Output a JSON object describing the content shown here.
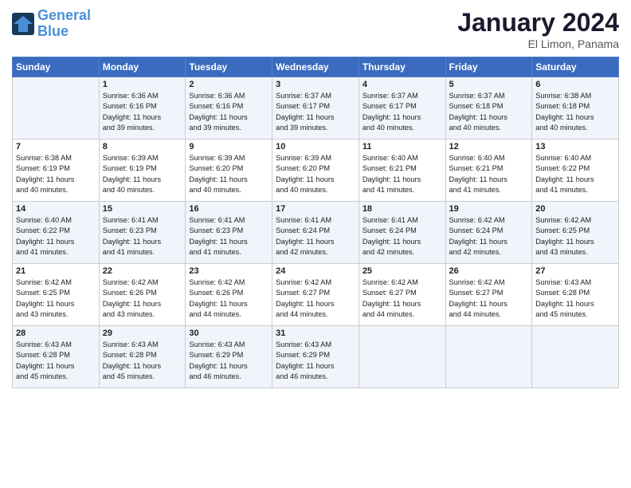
{
  "header": {
    "logo_line1": "General",
    "logo_line2": "Blue",
    "month_title": "January 2024",
    "location": "El Limon, Panama"
  },
  "weekdays": [
    "Sunday",
    "Monday",
    "Tuesday",
    "Wednesday",
    "Thursday",
    "Friday",
    "Saturday"
  ],
  "weeks": [
    [
      {
        "day": "",
        "info": ""
      },
      {
        "day": "1",
        "info": "Sunrise: 6:36 AM\nSunset: 6:16 PM\nDaylight: 11 hours\nand 39 minutes."
      },
      {
        "day": "2",
        "info": "Sunrise: 6:36 AM\nSunset: 6:16 PM\nDaylight: 11 hours\nand 39 minutes."
      },
      {
        "day": "3",
        "info": "Sunrise: 6:37 AM\nSunset: 6:17 PM\nDaylight: 11 hours\nand 39 minutes."
      },
      {
        "day": "4",
        "info": "Sunrise: 6:37 AM\nSunset: 6:17 PM\nDaylight: 11 hours\nand 40 minutes."
      },
      {
        "day": "5",
        "info": "Sunrise: 6:37 AM\nSunset: 6:18 PM\nDaylight: 11 hours\nand 40 minutes."
      },
      {
        "day": "6",
        "info": "Sunrise: 6:38 AM\nSunset: 6:18 PM\nDaylight: 11 hours\nand 40 minutes."
      }
    ],
    [
      {
        "day": "7",
        "info": "Sunrise: 6:38 AM\nSunset: 6:19 PM\nDaylight: 11 hours\nand 40 minutes."
      },
      {
        "day": "8",
        "info": "Sunrise: 6:39 AM\nSunset: 6:19 PM\nDaylight: 11 hours\nand 40 minutes."
      },
      {
        "day": "9",
        "info": "Sunrise: 6:39 AM\nSunset: 6:20 PM\nDaylight: 11 hours\nand 40 minutes."
      },
      {
        "day": "10",
        "info": "Sunrise: 6:39 AM\nSunset: 6:20 PM\nDaylight: 11 hours\nand 40 minutes."
      },
      {
        "day": "11",
        "info": "Sunrise: 6:40 AM\nSunset: 6:21 PM\nDaylight: 11 hours\nand 41 minutes."
      },
      {
        "day": "12",
        "info": "Sunrise: 6:40 AM\nSunset: 6:21 PM\nDaylight: 11 hours\nand 41 minutes."
      },
      {
        "day": "13",
        "info": "Sunrise: 6:40 AM\nSunset: 6:22 PM\nDaylight: 11 hours\nand 41 minutes."
      }
    ],
    [
      {
        "day": "14",
        "info": "Sunrise: 6:40 AM\nSunset: 6:22 PM\nDaylight: 11 hours\nand 41 minutes."
      },
      {
        "day": "15",
        "info": "Sunrise: 6:41 AM\nSunset: 6:23 PM\nDaylight: 11 hours\nand 41 minutes."
      },
      {
        "day": "16",
        "info": "Sunrise: 6:41 AM\nSunset: 6:23 PM\nDaylight: 11 hours\nand 41 minutes."
      },
      {
        "day": "17",
        "info": "Sunrise: 6:41 AM\nSunset: 6:24 PM\nDaylight: 11 hours\nand 42 minutes."
      },
      {
        "day": "18",
        "info": "Sunrise: 6:41 AM\nSunset: 6:24 PM\nDaylight: 11 hours\nand 42 minutes."
      },
      {
        "day": "19",
        "info": "Sunrise: 6:42 AM\nSunset: 6:24 PM\nDaylight: 11 hours\nand 42 minutes."
      },
      {
        "day": "20",
        "info": "Sunrise: 6:42 AM\nSunset: 6:25 PM\nDaylight: 11 hours\nand 43 minutes."
      }
    ],
    [
      {
        "day": "21",
        "info": "Sunrise: 6:42 AM\nSunset: 6:25 PM\nDaylight: 11 hours\nand 43 minutes."
      },
      {
        "day": "22",
        "info": "Sunrise: 6:42 AM\nSunset: 6:26 PM\nDaylight: 11 hours\nand 43 minutes."
      },
      {
        "day": "23",
        "info": "Sunrise: 6:42 AM\nSunset: 6:26 PM\nDaylight: 11 hours\nand 44 minutes."
      },
      {
        "day": "24",
        "info": "Sunrise: 6:42 AM\nSunset: 6:27 PM\nDaylight: 11 hours\nand 44 minutes."
      },
      {
        "day": "25",
        "info": "Sunrise: 6:42 AM\nSunset: 6:27 PM\nDaylight: 11 hours\nand 44 minutes."
      },
      {
        "day": "26",
        "info": "Sunrise: 6:42 AM\nSunset: 6:27 PM\nDaylight: 11 hours\nand 44 minutes."
      },
      {
        "day": "27",
        "info": "Sunrise: 6:43 AM\nSunset: 6:28 PM\nDaylight: 11 hours\nand 45 minutes."
      }
    ],
    [
      {
        "day": "28",
        "info": "Sunrise: 6:43 AM\nSunset: 6:28 PM\nDaylight: 11 hours\nand 45 minutes."
      },
      {
        "day": "29",
        "info": "Sunrise: 6:43 AM\nSunset: 6:28 PM\nDaylight: 11 hours\nand 45 minutes."
      },
      {
        "day": "30",
        "info": "Sunrise: 6:43 AM\nSunset: 6:29 PM\nDaylight: 11 hours\nand 46 minutes."
      },
      {
        "day": "31",
        "info": "Sunrise: 6:43 AM\nSunset: 6:29 PM\nDaylight: 11 hours\nand 46 minutes."
      },
      {
        "day": "",
        "info": ""
      },
      {
        "day": "",
        "info": ""
      },
      {
        "day": "",
        "info": ""
      }
    ]
  ]
}
